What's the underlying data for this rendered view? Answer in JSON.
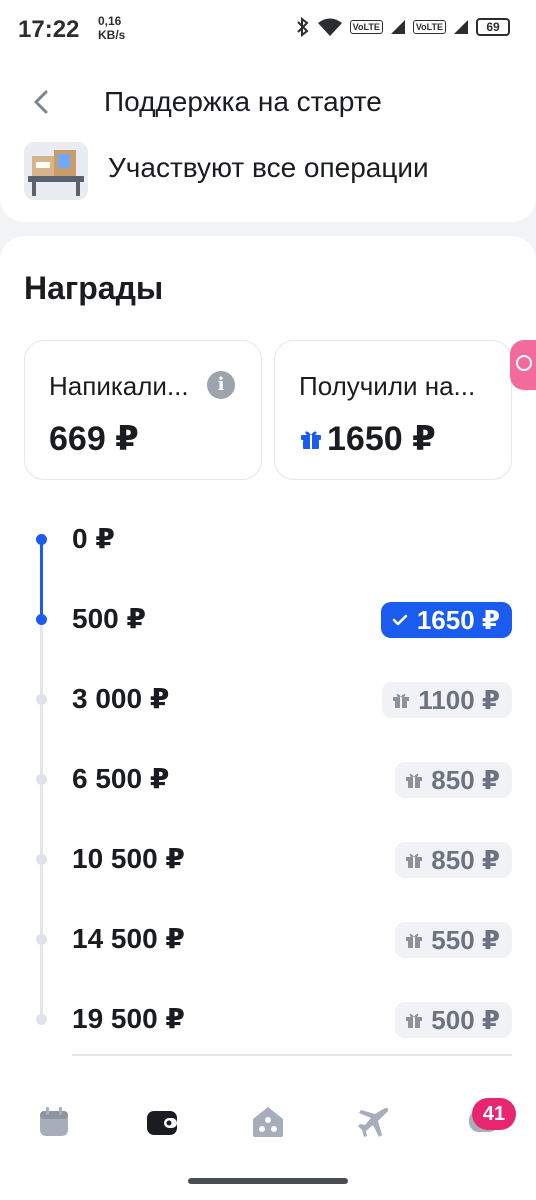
{
  "status_bar": {
    "time": "17:22",
    "speed_value": "0,16",
    "speed_unit": "KB/s",
    "volte1": "VoLTE",
    "volte2": "VoLTE",
    "battery": "69"
  },
  "header": {
    "title": "Поддержка на старте",
    "subtitle": "Участвуют все операции"
  },
  "rewards": {
    "section_title": "Награды",
    "cards": [
      {
        "label": "Напикали...",
        "value": "669 ₽"
      },
      {
        "label": "Получили на...",
        "value": "1650 ₽"
      }
    ]
  },
  "tiers": [
    {
      "threshold": "0 ₽",
      "reward": "",
      "achieved": true
    },
    {
      "threshold": "500 ₽",
      "reward": "1650 ₽",
      "achieved": true
    },
    {
      "threshold": "3 000 ₽",
      "reward": "1100 ₽",
      "achieved": false
    },
    {
      "threshold": "6 500 ₽",
      "reward": "850 ₽",
      "achieved": false
    },
    {
      "threshold": "10 500 ₽",
      "reward": "850 ₽",
      "achieved": false
    },
    {
      "threshold": "14 500 ₽",
      "reward": "550 ₽",
      "achieved": false
    },
    {
      "threshold": "19 500 ₽",
      "reward": "500 ₽",
      "achieved": false
    }
  ],
  "bottom_nav": {
    "items": [
      "calendar-icon",
      "wallet-icon",
      "home-icon",
      "plane-icon",
      "chat-icon"
    ],
    "active": "wallet-icon",
    "badge": "41"
  },
  "colors": {
    "accent": "#1a5cf0",
    "badge_pink": "#e8256f",
    "muted_badge": "#f0f2f5"
  }
}
